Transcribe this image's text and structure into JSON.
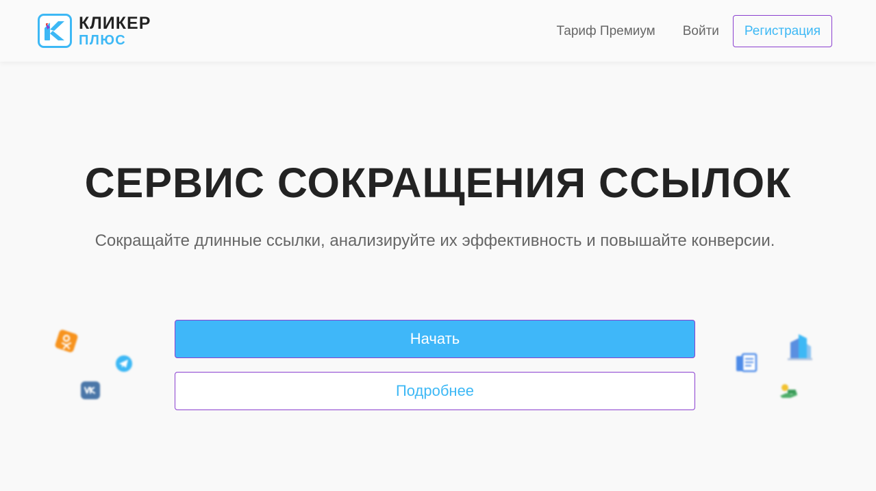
{
  "header": {
    "logo": {
      "word1": "КЛИКЕР",
      "word2": "ПЛЮС"
    },
    "nav": {
      "premium": "Тариф Премиум",
      "login": "Войти",
      "register": "Регистрация"
    }
  },
  "hero": {
    "title": "СЕРВИС СОКРАЩЕНИЯ ССЫЛОК",
    "subtitle": "Сокращайте длинные ссылки, анализируйте их эффективность и повышайте конверсии.",
    "start_button": "Начать",
    "more_button": "Подробнее"
  },
  "decorations": {
    "left": [
      "odnoklassniki-icon",
      "telegram-icon",
      "vk-icon"
    ],
    "right": [
      "buildings-icon",
      "form-icon",
      "money-hand-icon"
    ]
  },
  "colors": {
    "accent": "#3db8f5",
    "border": "#8a3fcf",
    "title": "#232323",
    "text": "#666666",
    "background": "#f9f9f9"
  }
}
